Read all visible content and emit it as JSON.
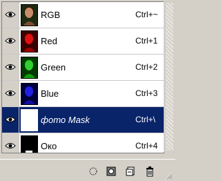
{
  "channels": [
    {
      "name": "RGB",
      "shortcut": "Ctrl+~",
      "thumb": "rgb",
      "selected": false
    },
    {
      "name": "Red",
      "shortcut": "Ctrl+1",
      "thumb": "red",
      "selected": false
    },
    {
      "name": "Green",
      "shortcut": "Ctrl+2",
      "thumb": "green",
      "selected": false
    },
    {
      "name": "Blue",
      "shortcut": "Ctrl+3",
      "thumb": "blue",
      "selected": false
    },
    {
      "name": "фото Mask",
      "shortcut": "Ctrl+\\",
      "thumb": "mask",
      "selected": true
    },
    {
      "name": "Око",
      "shortcut": "Ctrl+4",
      "thumb": "oko",
      "selected": false
    }
  ],
  "footer": {
    "buttons": [
      {
        "icon": "load-channel-selection-icon"
      },
      {
        "icon": "save-selection-as-channel-icon"
      },
      {
        "icon": "new-channel-icon"
      },
      {
        "icon": "delete-channel-icon"
      }
    ]
  },
  "colors": {
    "selected_row": "#0a246a",
    "panel_bg": "#d4d0c8"
  }
}
